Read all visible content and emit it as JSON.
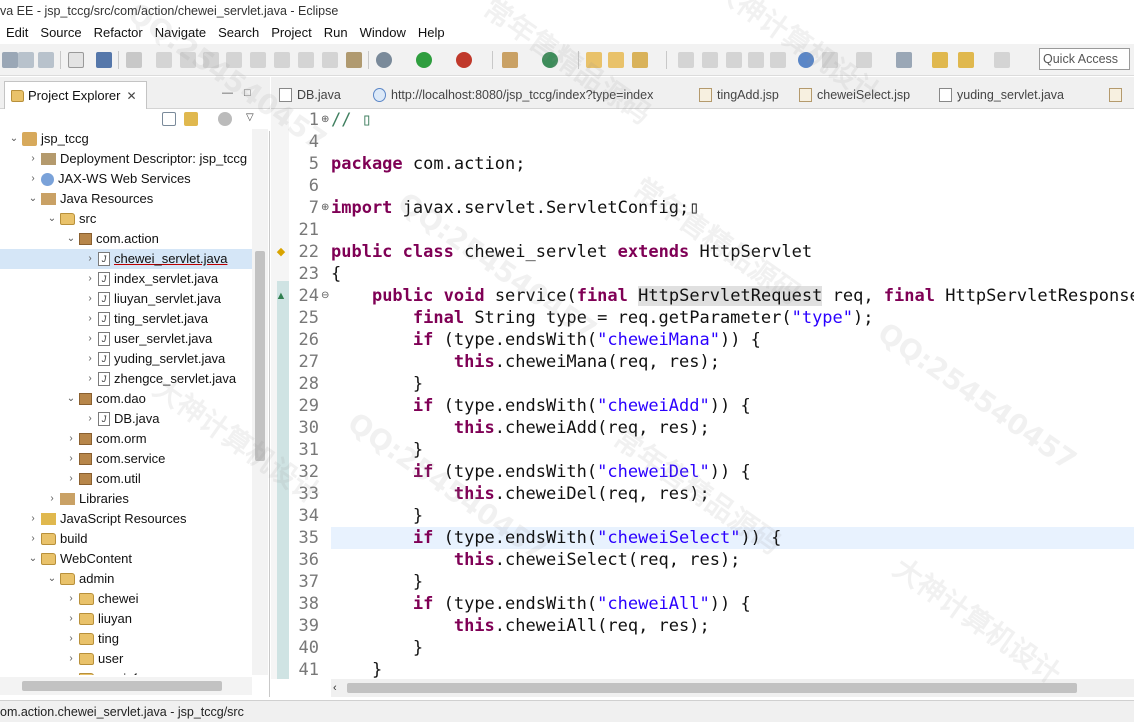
{
  "window": {
    "title": "va EE - jsp_tccg/src/com/action/chewei_servlet.java - Eclipse"
  },
  "menu": [
    "Edit",
    "Source",
    "Refactor",
    "Navigate",
    "Search",
    "Project",
    "Run",
    "Window",
    "Help"
  ],
  "toolbar": {
    "quick_access_placeholder": "Quick Access"
  },
  "explorer": {
    "tab_label": "Project Explorer",
    "close_glyph": "✕",
    "rows": [
      {
        "label": "jsp_tccg",
        "twisty": "⌄",
        "icon": "project"
      },
      {
        "label": "Deployment Descriptor: jsp_tccg",
        "twisty": "›",
        "icon": "desc"
      },
      {
        "label": "JAX-WS Web Services",
        "twisty": "›",
        "icon": "web"
      },
      {
        "label": "Java Resources",
        "twisty": "⌄",
        "icon": "lib"
      },
      {
        "label": "src",
        "twisty": "⌄",
        "icon": "folder"
      },
      {
        "label": "com.action",
        "twisty": "⌄",
        "icon": "pkg"
      },
      {
        "label": "chewei_servlet.java",
        "twisty": "›",
        "icon": "java",
        "selected": true
      },
      {
        "label": "index_servlet.java",
        "twisty": "›",
        "icon": "java"
      },
      {
        "label": "liuyan_servlet.java",
        "twisty": "›",
        "icon": "java"
      },
      {
        "label": "ting_servlet.java",
        "twisty": "›",
        "icon": "java"
      },
      {
        "label": "user_servlet.java",
        "twisty": "›",
        "icon": "java"
      },
      {
        "label": "yuding_servlet.java",
        "twisty": "›",
        "icon": "java"
      },
      {
        "label": "zhengce_servlet.java",
        "twisty": "›",
        "icon": "java"
      },
      {
        "label": "com.dao",
        "twisty": "⌄",
        "icon": "pkg"
      },
      {
        "label": "DB.java",
        "twisty": "›",
        "icon": "java"
      },
      {
        "label": "com.orm",
        "twisty": "›",
        "icon": "pkg"
      },
      {
        "label": "com.service",
        "twisty": "›",
        "icon": "pkg"
      },
      {
        "label": "com.util",
        "twisty": "›",
        "icon": "pkg"
      },
      {
        "label": "Libraries",
        "twisty": "›",
        "icon": "lib"
      },
      {
        "label": "JavaScript Resources",
        "twisty": "›",
        "icon": "js"
      },
      {
        "label": "build",
        "twisty": "›",
        "icon": "folder"
      },
      {
        "label": "WebContent",
        "twisty": "⌄",
        "icon": "folder"
      },
      {
        "label": "admin",
        "twisty": "⌄",
        "icon": "folder"
      },
      {
        "label": "chewei",
        "twisty": "›",
        "icon": "folder"
      },
      {
        "label": "liuyan",
        "twisty": "›",
        "icon": "folder"
      },
      {
        "label": "ting",
        "twisty": "›",
        "icon": "folder"
      },
      {
        "label": "user",
        "twisty": "›",
        "icon": "folder"
      },
      {
        "label": "userinfo",
        "twisty": "›",
        "icon": "folder"
      }
    ]
  },
  "editor_tabs": [
    {
      "label": "DB.java",
      "icon": "java"
    },
    {
      "label": "http://localhost:8080/jsp_tccg/index?type=index",
      "icon": "globe"
    },
    {
      "label": "tingAdd.jsp",
      "icon": "jsp"
    },
    {
      "label": "cheweiSelect.jsp",
      "icon": "jsp"
    },
    {
      "label": "yuding_servlet.java",
      "icon": "java"
    }
  ],
  "code_lines": [
    {
      "num": "1",
      "fold": "⊕",
      "tokens": [
        {
          "t": "// ",
          "c": "cm"
        },
        {
          "t": "▯",
          "c": "cm"
        }
      ]
    },
    {
      "num": "4",
      "tokens": []
    },
    {
      "num": "5",
      "tokens": [
        {
          "t": "package",
          "c": "kw"
        },
        {
          "t": " com.action;"
        }
      ]
    },
    {
      "num": "6",
      "tokens": []
    },
    {
      "num": "7",
      "fold": "⊕",
      "tokens": [
        {
          "t": "import",
          "c": "kw"
        },
        {
          "t": " javax.servlet.ServletConfig;▯"
        }
      ]
    },
    {
      "num": "21",
      "tokens": []
    },
    {
      "num": "22",
      "marker": "warn",
      "tokens": [
        {
          "t": "public",
          "c": "kw"
        },
        {
          "t": " "
        },
        {
          "t": "class",
          "c": "kw"
        },
        {
          "t": " chewei_servlet "
        },
        {
          "t": "extends",
          "c": "kw"
        },
        {
          "t": " HttpServlet"
        }
      ]
    },
    {
      "num": "23",
      "tokens": [
        {
          "t": "{"
        }
      ]
    },
    {
      "num": "24",
      "fold": "⊖",
      "marker": "up",
      "tokens": [
        {
          "t": "    "
        },
        {
          "t": "public",
          "c": "kw"
        },
        {
          "t": " "
        },
        {
          "t": "void",
          "c": "kw"
        },
        {
          "t": " service("
        },
        {
          "t": "final",
          "c": "kw"
        },
        {
          "t": " "
        },
        {
          "t": "HttpServletRequest",
          "c": "hl"
        },
        {
          "t": " req, "
        },
        {
          "t": "final",
          "c": "kw"
        },
        {
          "t": " HttpServletResponse res"
        }
      ]
    },
    {
      "num": "25",
      "tokens": [
        {
          "t": "        "
        },
        {
          "t": "final",
          "c": "kw"
        },
        {
          "t": " String type = req.getParameter("
        },
        {
          "t": "\"type\"",
          "c": "str"
        },
        {
          "t": ");"
        }
      ]
    },
    {
      "num": "26",
      "tokens": [
        {
          "t": "        "
        },
        {
          "t": "if",
          "c": "kw"
        },
        {
          "t": " (type.endsWith("
        },
        {
          "t": "\"cheweiMana\"",
          "c": "str"
        },
        {
          "t": ")) {"
        }
      ]
    },
    {
      "num": "27",
      "tokens": [
        {
          "t": "            "
        },
        {
          "t": "this",
          "c": "kw"
        },
        {
          "t": ".cheweiMana(req, res);"
        }
      ]
    },
    {
      "num": "28",
      "tokens": [
        {
          "t": "        }"
        }
      ]
    },
    {
      "num": "29",
      "tokens": [
        {
          "t": "        "
        },
        {
          "t": "if",
          "c": "kw"
        },
        {
          "t": " (type.endsWith("
        },
        {
          "t": "\"cheweiAdd\"",
          "c": "str"
        },
        {
          "t": ")) {"
        }
      ]
    },
    {
      "num": "30",
      "tokens": [
        {
          "t": "            "
        },
        {
          "t": "this",
          "c": "kw"
        },
        {
          "t": ".cheweiAdd(req, res);"
        }
      ]
    },
    {
      "num": "31",
      "tokens": [
        {
          "t": "        }"
        }
      ]
    },
    {
      "num": "32",
      "tokens": [
        {
          "t": "        "
        },
        {
          "t": "if",
          "c": "kw"
        },
        {
          "t": " (type.endsWith("
        },
        {
          "t": "\"cheweiDel\"",
          "c": "str"
        },
        {
          "t": ")) {"
        }
      ]
    },
    {
      "num": "33",
      "tokens": [
        {
          "t": "            "
        },
        {
          "t": "this",
          "c": "kw"
        },
        {
          "t": ".cheweiDel(req, res);"
        }
      ]
    },
    {
      "num": "34",
      "tokens": [
        {
          "t": "        }"
        }
      ]
    },
    {
      "num": "35",
      "current": true,
      "tokens": [
        {
          "t": "        "
        },
        {
          "t": "if",
          "c": "kw"
        },
        {
          "t": " (type.endsWith("
        },
        {
          "t": "\"cheweiSelect\"",
          "c": "str"
        },
        {
          "t": ")) {"
        }
      ]
    },
    {
      "num": "36",
      "tokens": [
        {
          "t": "            "
        },
        {
          "t": "this",
          "c": "kw"
        },
        {
          "t": ".cheweiSelect(req, res);"
        }
      ]
    },
    {
      "num": "37",
      "tokens": [
        {
          "t": "        }"
        }
      ]
    },
    {
      "num": "38",
      "tokens": [
        {
          "t": "        "
        },
        {
          "t": "if",
          "c": "kw"
        },
        {
          "t": " (type.endsWith("
        },
        {
          "t": "\"cheweiAll\"",
          "c": "str"
        },
        {
          "t": ")) {"
        }
      ]
    },
    {
      "num": "39",
      "tokens": [
        {
          "t": "            "
        },
        {
          "t": "this",
          "c": "kw"
        },
        {
          "t": ".cheweiAll(req, res);"
        }
      ]
    },
    {
      "num": "40",
      "tokens": [
        {
          "t": "        }"
        }
      ]
    },
    {
      "num": "41",
      "tokens": [
        {
          "t": "    }"
        }
      ]
    }
  ],
  "status": {
    "text": "om.action.chewei_servlet.java - jsp_tccg/src"
  },
  "watermarks": [
    "QQ:254540457",
    "常年售精品源码",
    "大神计算机设计",
    "QQ:254540457",
    "常年售精品源码",
    "大神计算机设计",
    "QQ:254540457",
    "常年售精品源码",
    "QQ:254540457",
    "大神计算机设计"
  ],
  "colors": {
    "keyword": "#7f0055",
    "string": "#2a00ff",
    "comment": "#3f7f5f",
    "selection": "#d5e6f7",
    "current_line": "#e8f2fe"
  }
}
